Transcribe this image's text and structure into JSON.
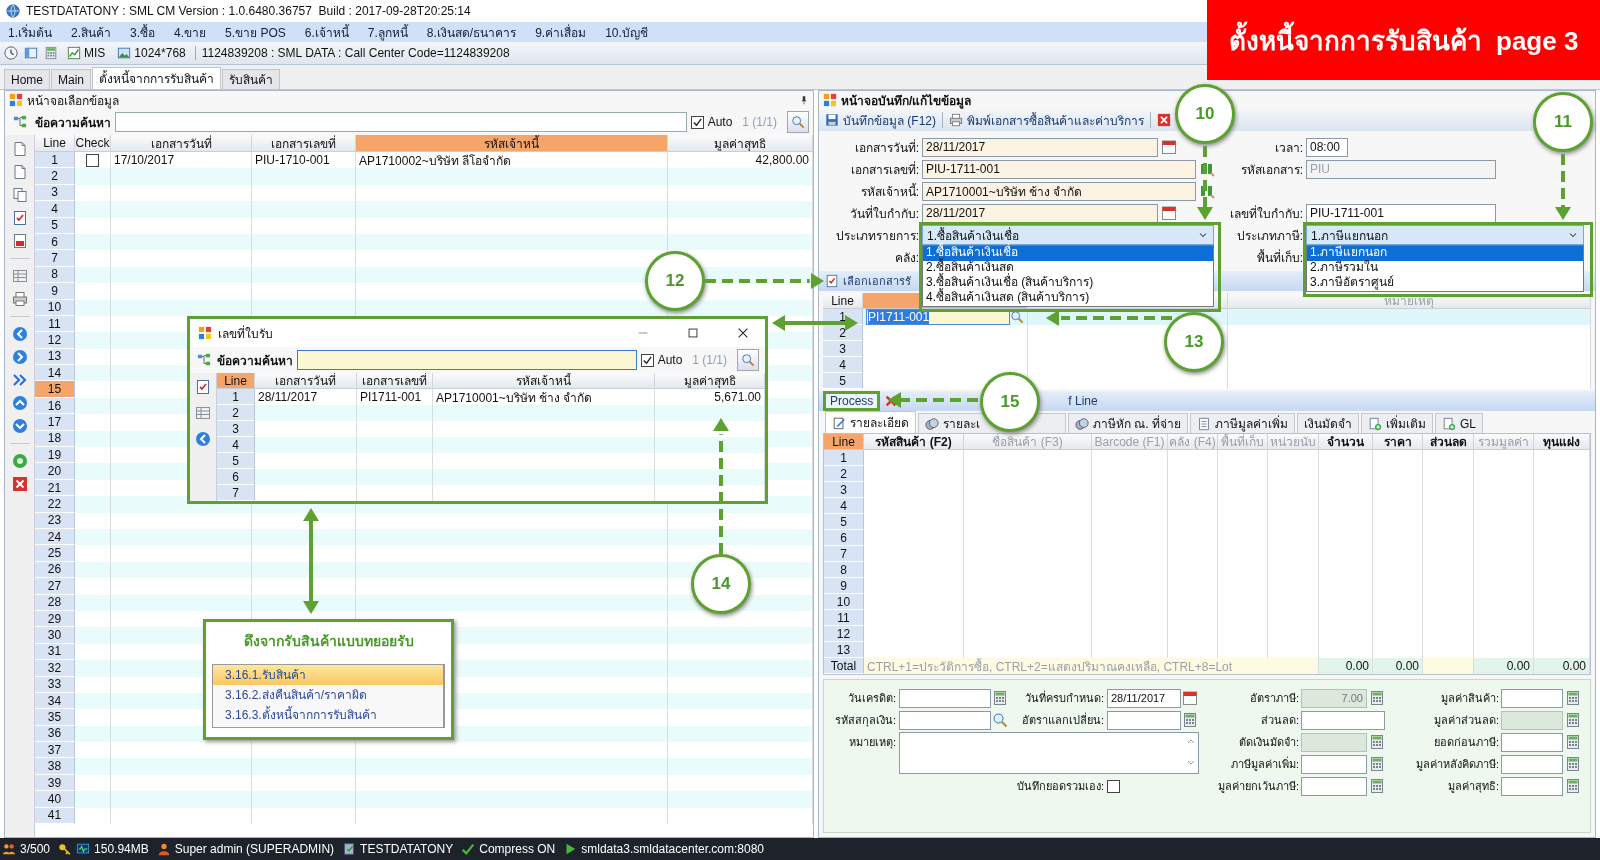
{
  "window": {
    "title": "TESTDATATONY : SML CM Version : 1.0.6480.36757  Build : 2017-09-28T20:25:14"
  },
  "menu": [
    "1.เริ่มต้น",
    "2.สินค้า",
    "3.ซื้อ",
    "4.ขาย",
    "5.ขาย POS",
    "6.เจ้าหนี้",
    "7.ลูกหนี้",
    "8.เงินสด/ธนาคาร",
    "9.ค่าเสื่อม",
    "10.บัญชี"
  ],
  "toolbar": {
    "buttons": [
      "MIS",
      "1024*768"
    ],
    "info": "1124839208 : SML DATA : Call Center Code=1124839208"
  },
  "tabs": [
    {
      "label": "Home",
      "selected": false
    },
    {
      "label": "Main",
      "selected": false
    },
    {
      "label": "ตั้งหนี้จากการรับสินค้า",
      "selected": true
    },
    {
      "label": "รับสินค้า",
      "selected": false
    }
  ],
  "banner": "ตั้งหนี้จากการรับสินค้า  page 3",
  "left_panel": {
    "title": "หน้าจอเลือกข้อมูล",
    "search_label": "ข้อความค้นหา",
    "auto": {
      "label": "Auto",
      "checked": true
    },
    "page": "1 (1/1)",
    "columns": [
      {
        "label": "Line",
        "accent": false
      },
      {
        "label": "Check",
        "accent": false
      },
      {
        "label": "เอกสารวันที่",
        "accent": false
      },
      {
        "label": "เอกสารเลขที่",
        "accent": false
      },
      {
        "label": "รหัสเจ้าหนี้",
        "accent": true
      },
      {
        "label": "มูลค่าสุทธิ",
        "accent": false
      }
    ],
    "rows": [
      {
        "line": "1",
        "selected": false,
        "checked": false,
        "date": "17/10/2017",
        "doc": "PIU-1710-001",
        "creditor": "AP1710002~บริษัท ลีโอจำกัด",
        "net": "42,800.00"
      },
      {
        "line": "2",
        "selected": false
      },
      {
        "line": "3",
        "selected": false
      },
      {
        "line": "4",
        "selected": false
      },
      {
        "line": "5",
        "selected": false
      },
      {
        "line": "6",
        "selected": false
      },
      {
        "line": "7",
        "selected": false
      },
      {
        "line": "8",
        "selected": false
      },
      {
        "line": "9",
        "selected": false
      },
      {
        "line": "10",
        "selected": false
      },
      {
        "line": "11",
        "selected": false
      },
      {
        "line": "12",
        "selected": false
      },
      {
        "line": "13",
        "selected": false
      },
      {
        "line": "14",
        "selected": false
      },
      {
        "line": "15",
        "selected": true
      },
      {
        "line": "16",
        "selected": false
      },
      {
        "line": "17",
        "selected": false
      },
      {
        "line": "18",
        "selected": false
      },
      {
        "line": "19",
        "selected": false
      },
      {
        "line": "20",
        "selected": false
      },
      {
        "line": "21",
        "selected": false
      },
      {
        "line": "22",
        "selected": false
      },
      {
        "line": "23",
        "selected": false
      },
      {
        "line": "24",
        "selected": false
      },
      {
        "line": "25",
        "selected": false
      },
      {
        "line": "26",
        "selected": false
      },
      {
        "line": "27",
        "selected": false
      },
      {
        "line": "28",
        "selected": false
      },
      {
        "line": "29",
        "selected": false
      },
      {
        "line": "30",
        "selected": false
      },
      {
        "line": "31",
        "selected": false
      },
      {
        "line": "32",
        "selected": false
      },
      {
        "line": "33",
        "selected": false
      },
      {
        "line": "34",
        "selected": false
      },
      {
        "line": "35",
        "selected": false
      },
      {
        "line": "36",
        "selected": false
      },
      {
        "line": "37",
        "selected": false
      },
      {
        "line": "38",
        "selected": false
      },
      {
        "line": "39",
        "selected": false
      },
      {
        "line": "40",
        "selected": false
      },
      {
        "line": "41",
        "selected": false
      }
    ]
  },
  "editor": {
    "title": "หน้าจอบันทึก/แก้ไขข้อมูล",
    "toolbar": [
      "บันทึกข้อมูล (F12)",
      "พิมพ์เอกสารซื้อสินค้าและค่าบริการ"
    ],
    "form_left": [
      {
        "label": "เอกสารวันที่:",
        "kind": "date",
        "value": "28/11/2017"
      },
      {
        "label": "เอกสารเลขที่:",
        "kind": "lookup",
        "value": "PIU-1711-001"
      },
      {
        "label": "รหัสเจ้าหนี้:",
        "kind": "lookup",
        "value": "AP1710001~บริษัท ช้าง จำกัด"
      },
      {
        "label": "วันที่ใบกำกับ:",
        "kind": "date",
        "value": "28/11/2017"
      },
      {
        "label": "ประเภทรายการ:",
        "kind": "combo",
        "value": "1.ซื้อสินค้าเงินเชื่อ",
        "options": [
          {
            "label": "1.ซื้อสินค้าเงินเชื่อ",
            "selected": true
          },
          {
            "label": "2.ซื้อสินค้าเงินสด",
            "selected": false
          },
          {
            "label": "3.ซื้อสินค้าเงินเชื่อ (สินค้าบริการ)",
            "selected": false
          },
          {
            "label": "4.ซื้อสินค้าเงินสด (สินค้าบริการ)",
            "selected": false
          }
        ]
      },
      {
        "label": "คลัง:",
        "kind": "label"
      }
    ],
    "form_right": [
      {
        "label": "เวลา:",
        "kind": "time",
        "value": "08:00"
      },
      {
        "label": "รหัสเอกสาร:",
        "kind": "text",
        "value": "PIU",
        "disabled": true
      },
      {
        "label": "เลขที่ใบกำกับ:",
        "kind": "text",
        "value": "PIU-1711-001",
        "disabled": false
      },
      {
        "label": "ประเภทภาษี:",
        "kind": "combo",
        "value": "1.ภาษีแยกนอก",
        "options": [
          {
            "label": "1.ภาษีแยกนอก",
            "selected": true
          },
          {
            "label": "2.ภาษีรวมใน",
            "selected": false
          },
          {
            "label": "3.ภาษีอัตราศูนย์",
            "selected": false
          }
        ]
      },
      {
        "label": "พื้นที่เก็บ:",
        "kind": "label"
      }
    ],
    "section": "เลือกเอกสารรั",
    "reference_grid": {
      "line_label": "Line",
      "note_label": "หมายเหตุ",
      "rows": [
        {
          "line": "1",
          "selected": true,
          "value": "PI1711-001"
        },
        {
          "line": "2",
          "selected": false
        },
        {
          "line": "3",
          "selected": false
        },
        {
          "line": "4",
          "selected": false
        },
        {
          "line": "5",
          "selected": false
        }
      ]
    },
    "process": {
      "button": "Process",
      "trailing": "f Line"
    },
    "detail_tabs": [
      {
        "label": "รายละเอียด",
        "selected": true
      },
      {
        "label": "รายละเ",
        "selected": false
      },
      {
        "label": "ภาษีหัก ณ. ที่จ่าย",
        "selected": false
      },
      {
        "label": "ภาษีมูลค่าเพิ่ม",
        "selected": false
      },
      {
        "label": "เงินมัดจำ",
        "selected": false
      },
      {
        "label": "เพิ่มเติม",
        "selected": false
      },
      {
        "label": "GL",
        "selected": false
      }
    ],
    "items": {
      "line_label": "Line",
      "columns": [
        {
          "label": "รหัสสินค้า (F2)",
          "disabled": false
        },
        {
          "label": "ชื่อสินค้า (F3)",
          "disabled": true
        },
        {
          "label": "Barcode (F1)",
          "disabled": true
        },
        {
          "label": "คลัง (F4)",
          "disabled": true
        },
        {
          "label": "พื้นที่เก็บ",
          "disabled": true
        },
        {
          "label": "หน่วยนับ",
          "disabled": true
        },
        {
          "label": "จำนวน",
          "disabled": false,
          "total": "0.00"
        },
        {
          "label": "ราคา",
          "disabled": false,
          "total": "0.00"
        },
        {
          "label": "ส่วนลด",
          "disabled": false
        },
        {
          "label": "รวมมูลค่า",
          "disabled": true,
          "total": "0.00"
        },
        {
          "label": "ทุนแฝง",
          "disabled": false,
          "total": "0.00"
        }
      ],
      "rows": [
        "1",
        "2",
        "3",
        "4",
        "5",
        "6",
        "7",
        "8",
        "9",
        "10",
        "11",
        "12",
        "13"
      ],
      "total_label": "Total",
      "hint": "CTRL+1=ประวัติการซื้อ, CTRL+2=แสดงปริมาณคงเหลือ, CTRL+8=Lot"
    },
    "footer": {
      "left": [
        {
          "label": "วันเครดิต:",
          "kind": "calc"
        },
        {
          "label": "วันที่ครบกำหนด:",
          "kind": "date",
          "value": "28/11/2017"
        },
        {
          "label": "รหัสสกุลเงิน:",
          "kind": "search"
        },
        {
          "label": "อัตราแลกเปลี่ยน:",
          "kind": "calc"
        }
      ],
      "memo": "หมายเหตุ:",
      "manual_total": {
        "label": "บันทึกยอดรวมเอง:",
        "checked": false
      },
      "tax": [
        {
          "label": "อัตราภาษี:",
          "kind": "calc",
          "value": "7.00",
          "disabled": true
        },
        {
          "label": "ส่วนลด:",
          "kind": "plain",
          "disabled": false
        },
        {
          "label": "ตัดเงินมัดจำ:",
          "kind": "calc",
          "disabled": true
        },
        {
          "label": "ภาษีมูลค่าเพิ่ม:",
          "kind": "calc",
          "disabled": false
        },
        {
          "label": "มูลค่ายกเว้นภาษี:",
          "kind": "calc",
          "disabled": false
        }
      ],
      "totals": [
        {
          "label": "มูลค่าสินค้า:",
          "kind": "calc",
          "disabled": false
        },
        {
          "label": "มูลค่าส่วนลด:",
          "kind": "calc",
          "disabled": true
        },
        {
          "label": "ยอดก่อนภาษี:",
          "kind": "calc",
          "disabled": false
        },
        {
          "label": "มูลค่าหลังคิดภาษี:",
          "kind": "calc",
          "disabled": false
        },
        {
          "label": "มูลค่าสุทธิ:",
          "kind": "calc",
          "disabled": false
        }
      ]
    }
  },
  "dialog": {
    "title": "เลขที่ใบรับ",
    "search_label": "ข้อความค้นหา",
    "auto": {
      "label": "Auto",
      "checked": true
    },
    "page": "1 (1/1)",
    "columns": [
      {
        "label": "Line",
        "accent": true
      },
      {
        "label": "เอกสารวันที่",
        "accent": false
      },
      {
        "label": "เอกสารเลขที่",
        "accent": false
      },
      {
        "label": "รหัสเจ้าหนี้",
        "accent": false
      },
      {
        "label": "มูลค่าสุทธิ",
        "accent": false
      }
    ],
    "rows": [
      {
        "line": "1",
        "date": "28/11/2017",
        "doc": "PI1711-001",
        "creditor": "AP1710001~บริษัท ช้าง จำกัด",
        "net": "5,671.00"
      },
      {
        "line": "2"
      },
      {
        "line": "3"
      },
      {
        "line": "4"
      },
      {
        "line": "5"
      },
      {
        "line": "6"
      },
      {
        "line": "7"
      }
    ]
  },
  "callout_box": {
    "title": "ดึงจากรับสินค้าแบบทยอยรับ",
    "items": [
      {
        "label": "3.16.1.รับสินค้า",
        "selected": true
      },
      {
        "label": "3.16.2.ส่งคืนสินค้า/ราคาผิด",
        "selected": false
      },
      {
        "label": "3.16.3.ตั้งหนี้จากการรับสินค้า",
        "selected": false
      }
    ]
  },
  "callouts": [
    "10",
    "11",
    "12",
    "13",
    "14",
    "15"
  ],
  "status_bar": [
    "3/500",
    "150.94MB",
    "Super admin (SUPERADMIN)",
    "TESTDATATONY",
    "Compress ON",
    "smldata3.smldatacenter.com:8080"
  ]
}
